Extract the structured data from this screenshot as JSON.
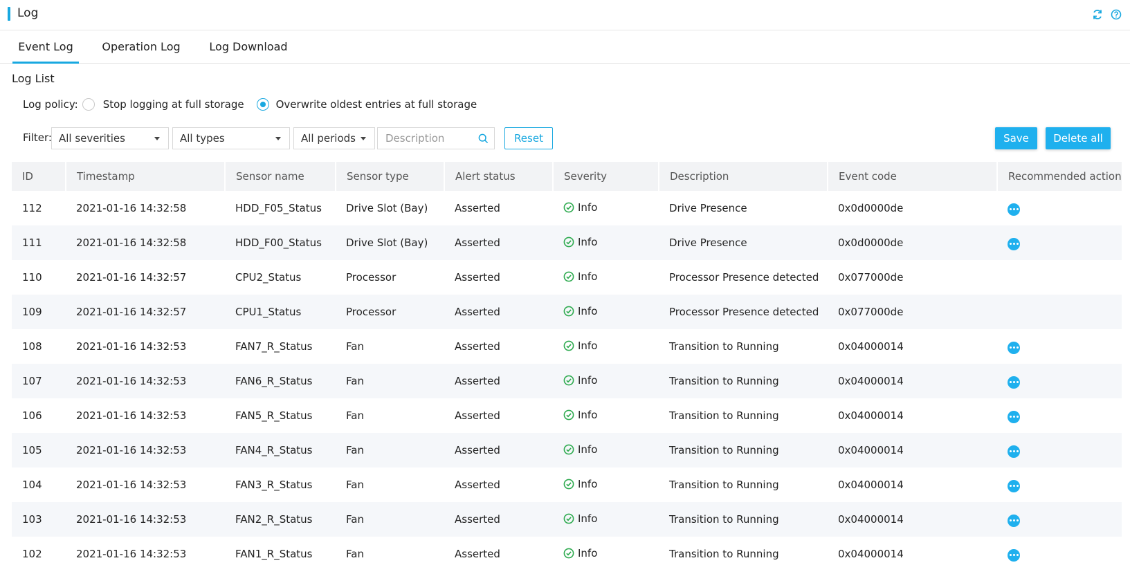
{
  "header": {
    "title": "Log",
    "refresh_icon": "refresh-icon",
    "help_icon": "help-icon",
    "accent_color": "#18a8e0"
  },
  "tabs": [
    {
      "label": "Event Log",
      "active": true
    },
    {
      "label": "Operation Log",
      "active": false
    },
    {
      "label": "Log Download",
      "active": false
    }
  ],
  "section_title": "Log List",
  "policy": {
    "label": "Log policy:",
    "options": [
      {
        "label": "Stop logging at full storage",
        "checked": false
      },
      {
        "label": "Overwrite oldest entries at full storage",
        "checked": true
      }
    ]
  },
  "filter": {
    "label": "Filter:",
    "severity": "All severities",
    "type": "All types",
    "period": "All periods",
    "search_placeholder": "Description",
    "reset_label": "Reset"
  },
  "actions": {
    "save_label": "Save",
    "delete_all_label": "Delete all"
  },
  "table": {
    "columns": [
      "ID",
      "Timestamp",
      "Sensor name",
      "Sensor type",
      "Alert status",
      "Severity",
      "Description",
      "Event code",
      "Recommended action"
    ],
    "rows": [
      {
        "id": "112",
        "timestamp": "2021-01-16 14:32:58",
        "sensor_name": "HDD_F05_Status",
        "sensor_type": "Drive Slot (Bay)",
        "alert_status": "Asserted",
        "severity": "Info",
        "description": "Drive Presence",
        "event_code": "0x0d0000de",
        "has_action": true
      },
      {
        "id": "111",
        "timestamp": "2021-01-16 14:32:58",
        "sensor_name": "HDD_F00_Status",
        "sensor_type": "Drive Slot (Bay)",
        "alert_status": "Asserted",
        "severity": "Info",
        "description": "Drive Presence",
        "event_code": "0x0d0000de",
        "has_action": true
      },
      {
        "id": "110",
        "timestamp": "2021-01-16 14:32:57",
        "sensor_name": "CPU2_Status",
        "sensor_type": "Processor",
        "alert_status": "Asserted",
        "severity": "Info",
        "description": "Processor Presence detected",
        "event_code": "0x077000de",
        "has_action": false
      },
      {
        "id": "109",
        "timestamp": "2021-01-16 14:32:57",
        "sensor_name": "CPU1_Status",
        "sensor_type": "Processor",
        "alert_status": "Asserted",
        "severity": "Info",
        "description": "Processor Presence detected",
        "event_code": "0x077000de",
        "has_action": false
      },
      {
        "id": "108",
        "timestamp": "2021-01-16 14:32:53",
        "sensor_name": "FAN7_R_Status",
        "sensor_type": "Fan",
        "alert_status": "Asserted",
        "severity": "Info",
        "description": "Transition to Running",
        "event_code": "0x04000014",
        "has_action": true
      },
      {
        "id": "107",
        "timestamp": "2021-01-16 14:32:53",
        "sensor_name": "FAN6_R_Status",
        "sensor_type": "Fan",
        "alert_status": "Asserted",
        "severity": "Info",
        "description": "Transition to Running",
        "event_code": "0x04000014",
        "has_action": true
      },
      {
        "id": "106",
        "timestamp": "2021-01-16 14:32:53",
        "sensor_name": "FAN5_R_Status",
        "sensor_type": "Fan",
        "alert_status": "Asserted",
        "severity": "Info",
        "description": "Transition to Running",
        "event_code": "0x04000014",
        "has_action": true
      },
      {
        "id": "105",
        "timestamp": "2021-01-16 14:32:53",
        "sensor_name": "FAN4_R_Status",
        "sensor_type": "Fan",
        "alert_status": "Asserted",
        "severity": "Info",
        "description": "Transition to Running",
        "event_code": "0x04000014",
        "has_action": true
      },
      {
        "id": "104",
        "timestamp": "2021-01-16 14:32:53",
        "sensor_name": "FAN3_R_Status",
        "sensor_type": "Fan",
        "alert_status": "Asserted",
        "severity": "Info",
        "description": "Transition to Running",
        "event_code": "0x04000014",
        "has_action": true
      },
      {
        "id": "103",
        "timestamp": "2021-01-16 14:32:53",
        "sensor_name": "FAN2_R_Status",
        "sensor_type": "Fan",
        "alert_status": "Asserted",
        "severity": "Info",
        "description": "Transition to Running",
        "event_code": "0x04000014",
        "has_action": true
      },
      {
        "id": "102",
        "timestamp": "2021-01-16 14:32:53",
        "sensor_name": "FAN1_R_Status",
        "sensor_type": "Fan",
        "alert_status": "Asserted",
        "severity": "Info",
        "description": "Transition to Running",
        "event_code": "0x04000014",
        "has_action": true
      }
    ]
  },
  "colors": {
    "accent": "#18a8e0",
    "primary_button": "#1fb0ee",
    "info_green": "#2eaa4f",
    "header_bg": "#f2f3f5",
    "stripe_bg": "#f5f7fa"
  }
}
